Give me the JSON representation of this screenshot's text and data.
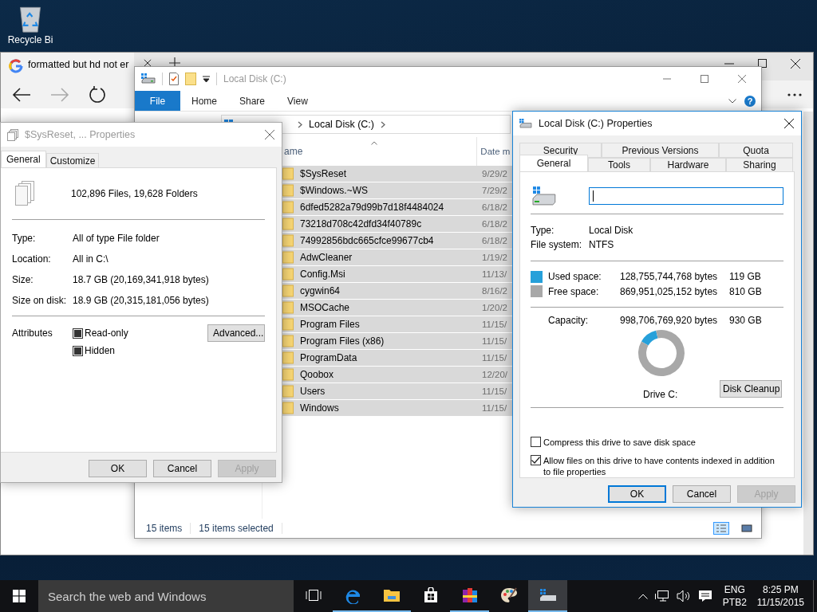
{
  "desktop": {
    "icon_label": "Recycle Bi"
  },
  "browser": {
    "tab_title": "formatted but hd not er"
  },
  "explorer": {
    "title": "Local Disk (C:)",
    "active": false,
    "ribbon_tabs": [
      {
        "label": "File",
        "selected": true
      },
      {
        "label": "Home",
        "selected": false
      },
      {
        "label": "Share",
        "selected": false
      },
      {
        "label": "View",
        "selected": false
      }
    ],
    "help": "?",
    "breadcrumb": "Local Disk (C:)",
    "columns": [
      "ame",
      "Date m"
    ],
    "rows": [
      {
        "name": "$SysReset",
        "date": "9/29/2",
        "selected": true
      },
      {
        "name": "$Windows.~WS",
        "date": "7/29/2",
        "selected": true
      },
      {
        "name": "6dfed5282a79d99b7d18f4484024",
        "date": "6/18/2",
        "selected": true
      },
      {
        "name": "73218d708c42dfd34f40789c",
        "date": "6/18/2",
        "selected": true
      },
      {
        "name": "74992856bdc665cfce99677cb4",
        "date": "6/18/2",
        "selected": true
      },
      {
        "name": "AdwCleaner",
        "date": "1/19/2",
        "selected": true
      },
      {
        "name": "Config.Msi",
        "date": "11/13/",
        "selected": true
      },
      {
        "name": "cygwin64",
        "date": "8/16/2",
        "selected": true
      },
      {
        "name": "MSOCache",
        "date": "1/20/2",
        "selected": true
      },
      {
        "name": "Program Files",
        "date": "11/15/",
        "selected": true
      },
      {
        "name": "Program Files (x86)",
        "date": "11/15/",
        "selected": true
      },
      {
        "name": "ProgramData",
        "date": "11/15/",
        "selected": true
      },
      {
        "name": "Qoobox",
        "date": "12/20/",
        "selected": true
      },
      {
        "name": "Users",
        "date": "11/15/",
        "selected": true
      },
      {
        "name": "Windows",
        "date": "11/15/",
        "selected": true
      }
    ],
    "status": [
      "15 items",
      "15 items selected"
    ],
    "views": [
      {
        "kind": "details",
        "selected": true
      },
      {
        "kind": "thumbnails",
        "selected": false
      }
    ]
  },
  "folder_properties": {
    "title": "$SysReset, ... Properties",
    "active": false,
    "tabs": [
      {
        "label": "General",
        "selected": true
      },
      {
        "label": "Customize",
        "selected": false
      }
    ],
    "summary": "102,896 Files, 19,628 Folders",
    "fields": [
      {
        "label": "Type:",
        "value": "All of type File folder"
      },
      {
        "label": "Location:",
        "value": "All in C:\\"
      },
      {
        "label": "Size:",
        "value": "18.7 GB (20,169,341,918 bytes)"
      },
      {
        "label": "Size on disk:",
        "value": "18.9 GB (20,315,181,056 bytes)"
      }
    ],
    "attributes_label": "Attributes",
    "attributes": [
      {
        "label": "Read-only",
        "mixed": true
      },
      {
        "label": "Hidden",
        "mixed": true
      }
    ],
    "advanced_button": "Advanced...",
    "buttons": [
      {
        "label": "OK",
        "disabled": false,
        "default": false
      },
      {
        "label": "Cancel",
        "disabled": false,
        "default": false
      },
      {
        "label": "Apply",
        "disabled": true,
        "default": false
      }
    ]
  },
  "drive_properties": {
    "title": "Local Disk (C:) Properties",
    "active": true,
    "tab_rows": [
      {
        "tabs": [
          {
            "label": "Security",
            "selected": false
          },
          {
            "label": "Previous Versions",
            "selected": false
          },
          {
            "label": "Quota",
            "selected": false
          }
        ]
      },
      {
        "tabs": [
          {
            "label": "General",
            "selected": true
          },
          {
            "label": "Tools",
            "selected": false
          },
          {
            "label": "Hardware",
            "selected": false
          },
          {
            "label": "Sharing",
            "selected": false
          }
        ]
      }
    ],
    "fields": [
      {
        "label": "Type:",
        "value": "Local Disk"
      },
      {
        "label": "File system:",
        "value": "NTFS"
      }
    ],
    "space": [
      {
        "label": "Used space:",
        "bytes": "128,755,744,768 bytes",
        "size": "119 GB",
        "color": "#26a0da"
      },
      {
        "label": "Free space:",
        "bytes": "869,951,025,152 bytes",
        "size": "810 GB",
        "color": "#a8a8a8"
      }
    ],
    "capacity": {
      "label": "Capacity:",
      "bytes": "998,706,769,920 bytes",
      "size": "930 GB"
    },
    "chart_data": {
      "type": "donut",
      "values": [
        12.9,
        87.1
      ]
    },
    "drive_label": "Drive C:",
    "cleanup_button": "Disk Cleanup",
    "options": [
      {
        "label": "Compress this drive to save disk space",
        "checked": false
      },
      {
        "label": "Allow files on this drive to have contents indexed in addition to file properties",
        "checked": true
      }
    ],
    "buttons": [
      {
        "label": "OK",
        "disabled": false,
        "default": true
      },
      {
        "label": "Cancel",
        "disabled": false,
        "default": false
      },
      {
        "label": "Apply",
        "disabled": true,
        "default": false
      }
    ]
  },
  "taskbar": {
    "search": {
      "placeholder": "Search the web and Windows"
    },
    "apps": [
      {
        "kind": "task-view",
        "running": false,
        "active": false
      },
      {
        "kind": "browser",
        "running": true,
        "active": false
      },
      {
        "kind": "folder",
        "running": true,
        "active": false
      },
      {
        "kind": "store",
        "running": false,
        "active": false
      },
      {
        "kind": "books",
        "running": true,
        "active": false
      },
      {
        "kind": "palette",
        "running": false,
        "active": false
      },
      {
        "kind": "drive",
        "running": true,
        "active": true
      }
    ],
    "tray": {
      "language": "ENG",
      "layout": "PTB2",
      "time": "8:25 PM",
      "date": "11/15/2015"
    }
  }
}
